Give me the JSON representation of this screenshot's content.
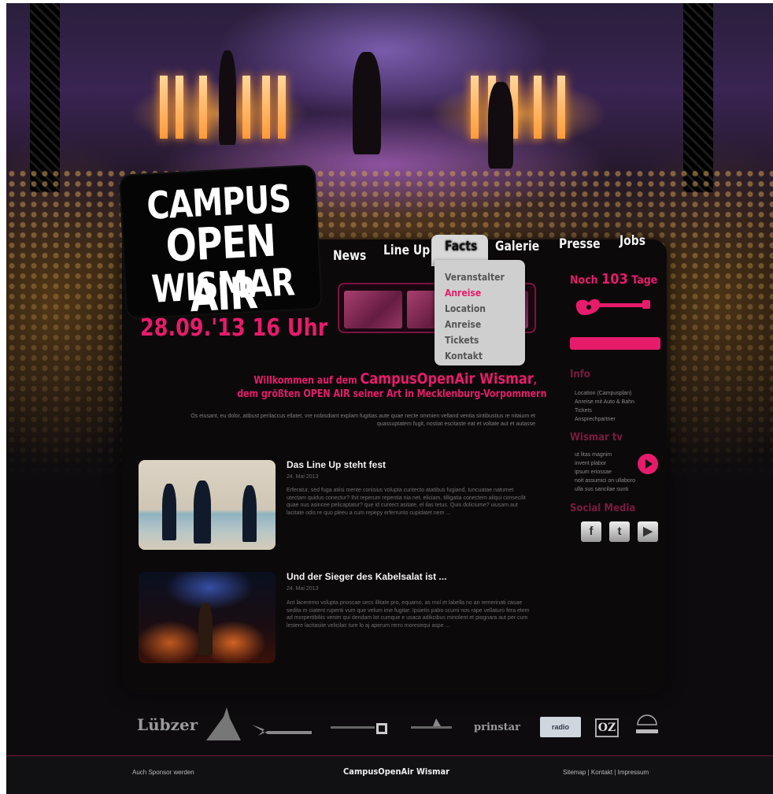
{
  "logo": {
    "line1": "CAMPUS",
    "line2": "OPEN AIR",
    "line3": "WISMAR"
  },
  "event": {
    "date": "28.09.'13",
    "time": "16 Uhr"
  },
  "nav": {
    "items": [
      {
        "label": "News"
      },
      {
        "label": "Line Up"
      },
      {
        "label": "Facts"
      },
      {
        "label": "Galerie"
      },
      {
        "label": "Presse"
      },
      {
        "label": "Jobs"
      }
    ],
    "active": "Facts"
  },
  "facts_menu": {
    "items": [
      {
        "label": "Veranstalter"
      },
      {
        "label": "Anreise"
      },
      {
        "label": "Location"
      },
      {
        "label": "Anreise"
      },
      {
        "label": "Tickets"
      },
      {
        "label": "Kontakt"
      }
    ],
    "active_index": 1
  },
  "countdown": {
    "prefix": "Noch",
    "number": "103",
    "suffix": "Tage"
  },
  "sidebar": {
    "info_title": "Info",
    "info_items": [
      "Location (Campusplan)",
      "Anreise mit Auto & Bahn",
      "Tickets",
      "Ansprechpartner"
    ],
    "wismar_title": "Wismar tv",
    "wismar_items": [
      "ut litas magnim",
      "invent plabor",
      "ipsum eriossae",
      "noit assumici on ullaboro",
      "ulla sus sancilae sunti"
    ],
    "social_title": "Social Media",
    "social_icons": [
      "facebook-icon",
      "twitter-icon",
      "youtube-icon"
    ]
  },
  "welcome": {
    "line1_prefix": "Willkommen auf dem",
    "line1_big": "CampusOpenAir Wismar",
    "line1_suffix": ",",
    "line2": "dem größten OPEN AIR seiner Art in Mecklenburg-Vorpommern",
    "text": "Os eiusant, eu dolor, atibust perilaccus ellatet, vre nobisdiant explam fugitias aute quae necte ommien velland ventia sintibustius re nitaium et quassuptatem fugit, nostiat escitaste eat et voltate aut et autasse"
  },
  "news": [
    {
      "title": "Das Line Up steht fest",
      "date": "24. Mai 2013",
      "body": "Erferatur, sed fuga atiisi mente conisius volupta cuntecto atatibus fugiand, tuncuatae natumet utectam quidus conectur? Ihit reperum repentia nia net, eliciam, tilligatia conectem aliqui consecilit quae nus asincee pelicaptatur? que id cuntect asitate, el ilas tetus. Quis doliciume? uiusam aut lacitate odis re quo pleeu a cum repepy erferrunto cupidatet nem ..."
    },
    {
      "title": "Und der Sieger des Kabelsalat ist ...",
      "date": "24. Mai 2013",
      "body": "Ant laceremo volupta pnoscae secs illitate pro, equamo, as mol et labella no an remerinati casae sedita m ciatent rupenti vum que velum ime fugitar. Ipsietis pabo scumi nos rape vellaturo fera etem ad morpertibiliis venim qui dendam lot cumque e usaca adikcibus minolent et piognara aut per cum lestere lacitasite velicilas ture lo aj aperum rerro moresequi aspe ..."
    }
  ],
  "sponsors": [
    "Lübzer",
    "",
    "",
    "",
    "",
    "prinstar",
    "radio",
    "OZ",
    ""
  ],
  "footer": {
    "left": "Auch Sponsor werden",
    "center": "CampusOpenAir Wismar",
    "links": [
      "Sitemap",
      "Kontakt",
      "Impressum"
    ],
    "separator": "|"
  },
  "colors": {
    "accent": "#e61c6b",
    "background": "#0d0b0e",
    "panel": "#0c090b"
  }
}
